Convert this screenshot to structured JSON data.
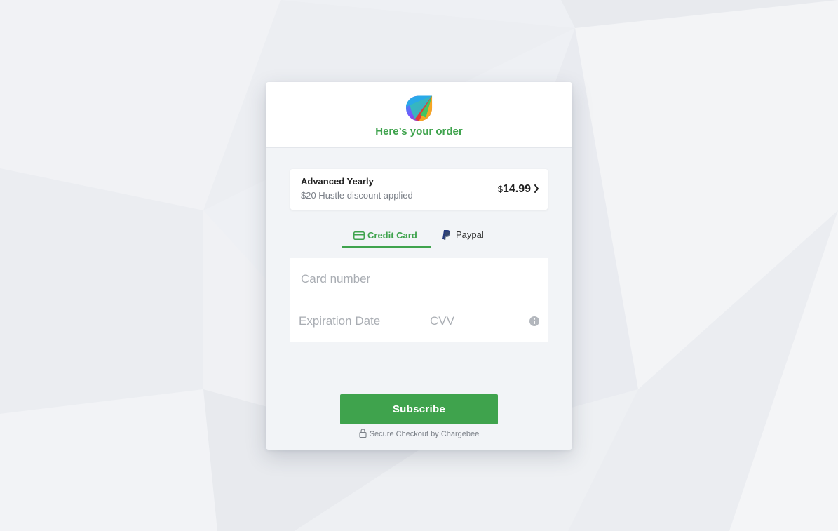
{
  "colors": {
    "accent": "#3fa34d",
    "modal_bg": "#f2f4f7",
    "page_bg": "#eef0f4"
  },
  "header": {
    "logo_icon": "leaf-logo-icon",
    "title": "Here’s your order"
  },
  "plan": {
    "name": "Advanced Yearly",
    "discount": "$20 Hustle discount applied",
    "currency": "$",
    "price": "14.99",
    "chevron_icon": "chevron-right-icon"
  },
  "tabs": [
    {
      "label": "Credit Card",
      "icon": "credit-card-icon",
      "active": true
    },
    {
      "label": "Paypal",
      "icon": "paypal-icon",
      "active": false
    }
  ],
  "form": {
    "card_number_placeholder": "Card number",
    "expiration_placeholder": "Expiration Date",
    "cvv_placeholder": "CVV",
    "info_icon": "info-icon"
  },
  "subscribe_label": "Subscribe",
  "secure_text": "Secure Checkout by Chargebee"
}
